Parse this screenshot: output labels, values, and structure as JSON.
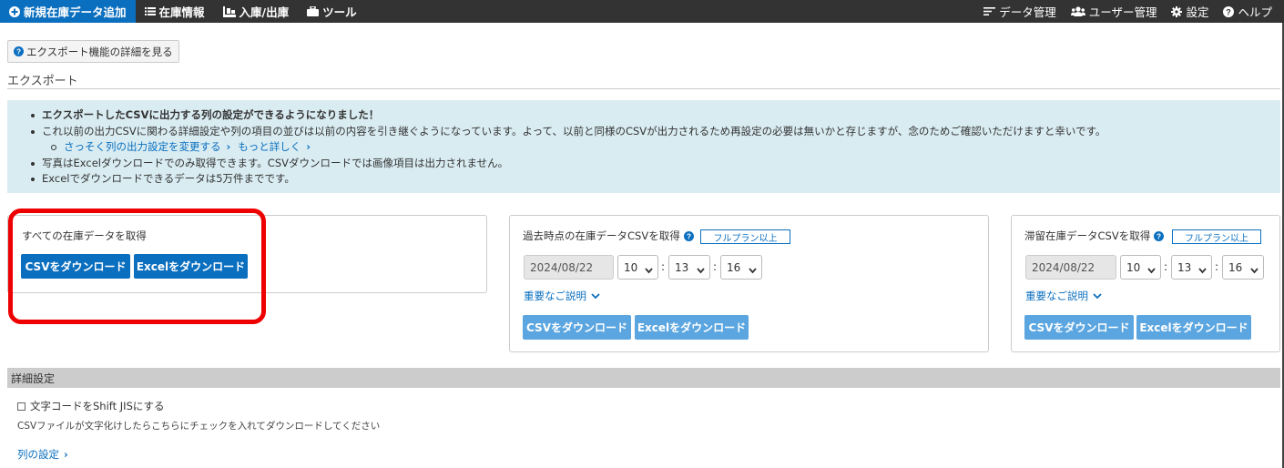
{
  "nav": {
    "left": [
      {
        "label": "新規在庫データ追加",
        "icon": "plus-circle-icon"
      },
      {
        "label": "在庫情報",
        "icon": "list-icon"
      },
      {
        "label": "入庫/出庫",
        "icon": "inout-icon"
      },
      {
        "label": "ツール",
        "icon": "toolbox-icon"
      }
    ],
    "right": [
      {
        "label": "データ管理",
        "icon": "data-lines-icon"
      },
      {
        "label": "ユーザー管理",
        "icon": "users-icon"
      },
      {
        "label": "設定",
        "icon": "gear-icon"
      },
      {
        "label": "ヘルプ",
        "icon": "help-icon"
      }
    ]
  },
  "detail_button": {
    "label": "エクスポート機能の詳細を見る",
    "icon": "help-icon"
  },
  "section_title": "エクスポート",
  "info": {
    "line1": "エクスポートしたCSVに出力する列の設定ができるようになりました！",
    "line2": "これ以前の出力CSVに関わる詳細設定や列の項目の並びは以前の内容を引き継ぐようになっています。よって、以前と同様のCSVが出力されるため再設定の必要は無いかと存じますが、念のためご確認いただけますと幸いです。",
    "link1": "さっそく列の出力設定を変更する",
    "link2": "もっと詳しく",
    "line3": "写真はExcelダウンロードでのみ取得できます。CSVダウンロードでは画像項目は出力されません。",
    "line4": "Excelでダウンロードできるデータは5万件までです。"
  },
  "panel_all": {
    "heading": "すべての在庫データを取得",
    "csv_button": "CSVをダウンロード",
    "excel_button": "Excelをダウンロード"
  },
  "panel_past": {
    "heading": "過去時点の在庫データCSVを取得",
    "badge": "フルプラン以上",
    "date": "2024/08/22",
    "hour": "10",
    "minute": "13",
    "second": "16",
    "separator": ":",
    "toggle": "重要なご説明",
    "csv_button": "CSVをダウンロード",
    "excel_button": "Excelをダウンロード"
  },
  "panel_stale": {
    "heading": "滞留在庫データCSVを取得",
    "badge": "フルプラン以上",
    "date": "2024/08/22",
    "hour": "10",
    "minute": "13",
    "second": "16",
    "separator": ":",
    "toggle": "重要なご説明",
    "csv_button": "CSVをダウンロード",
    "excel_button": "Excelをダウンロード"
  },
  "advanced": {
    "header": "詳細設定",
    "checkbox_label": "文字コードをShift JISにする",
    "checkbox_checked": false,
    "note": "CSVファイルが文字化けしたらこちらにチェックを入れてダウンロードしてください",
    "columns_link": "列の設定"
  },
  "colors": {
    "nav_bg": "#333333",
    "accent": "#0b6fbf",
    "info_bg": "#d9ecf2",
    "button_disabled": "#5ba6e0",
    "highlight": "#ee0000"
  }
}
